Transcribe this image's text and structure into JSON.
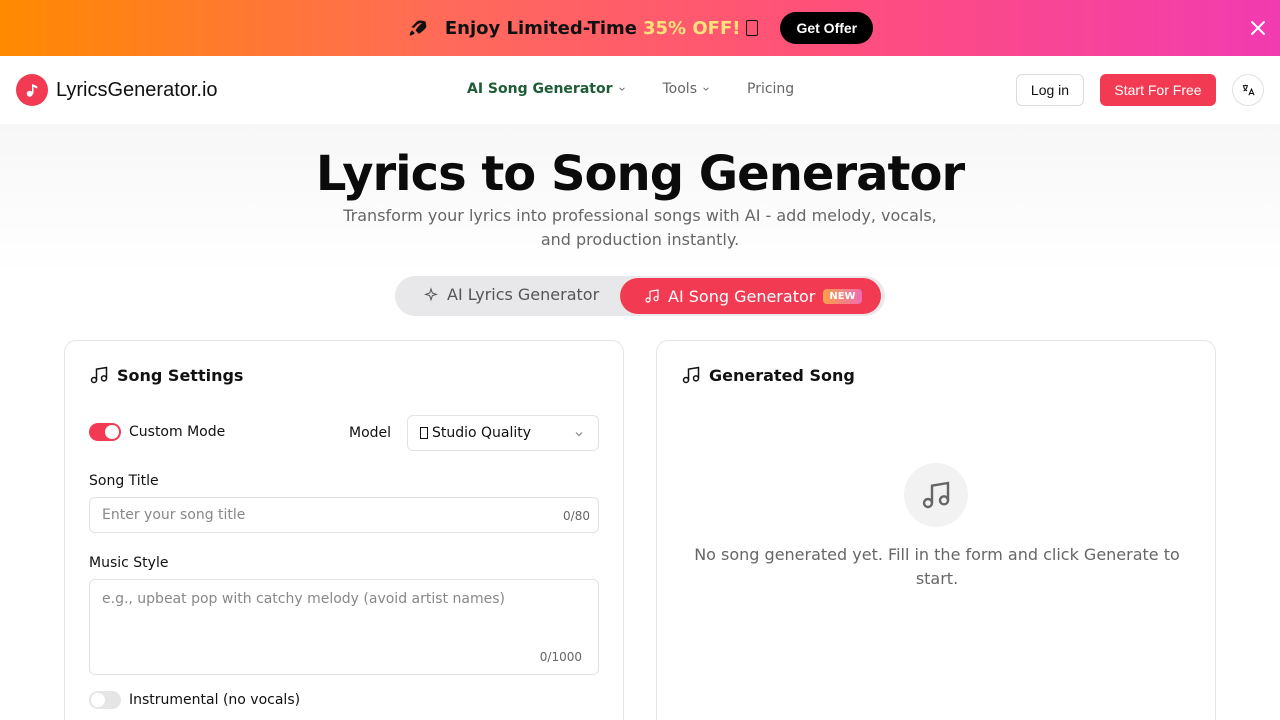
{
  "promo": {
    "text": "Enjoy Limited-Time",
    "highlight": "35% OFF!",
    "button": "Get Offer"
  },
  "nav": {
    "logo": "LyricsGenerator.io",
    "links": [
      "AI Song Generator",
      "Tools",
      "Pricing"
    ],
    "login": "Log in",
    "start": "Start For Free"
  },
  "hero": {
    "title": "Lyrics to Song Generator",
    "subtitle": "Transform your lyrics into professional songs with AI - add melody, vocals, and production instantly."
  },
  "modes": {
    "lyrics": "AI Lyrics Generator",
    "song": "AI Song Generator",
    "badge": "NEW"
  },
  "settings": {
    "title": "Song Settings",
    "custom_mode": "Custom Mode",
    "model_label": "Model",
    "model_value": "Studio Quality",
    "song_title_label": "Song Title",
    "song_title_placeholder": "Enter your song title",
    "song_title_counter": "0/80",
    "music_style_label": "Music Style",
    "music_style_placeholder": "e.g., upbeat pop with catchy melody (avoid artist names)",
    "music_style_counter": "0/1000",
    "instrumental": "Instrumental (no vocals)"
  },
  "output": {
    "title": "Generated Song",
    "empty": "No song generated yet. Fill in the form and click Generate to start."
  },
  "colors": {
    "accent": "#f23a52",
    "nav_active": "#1e5c36"
  }
}
